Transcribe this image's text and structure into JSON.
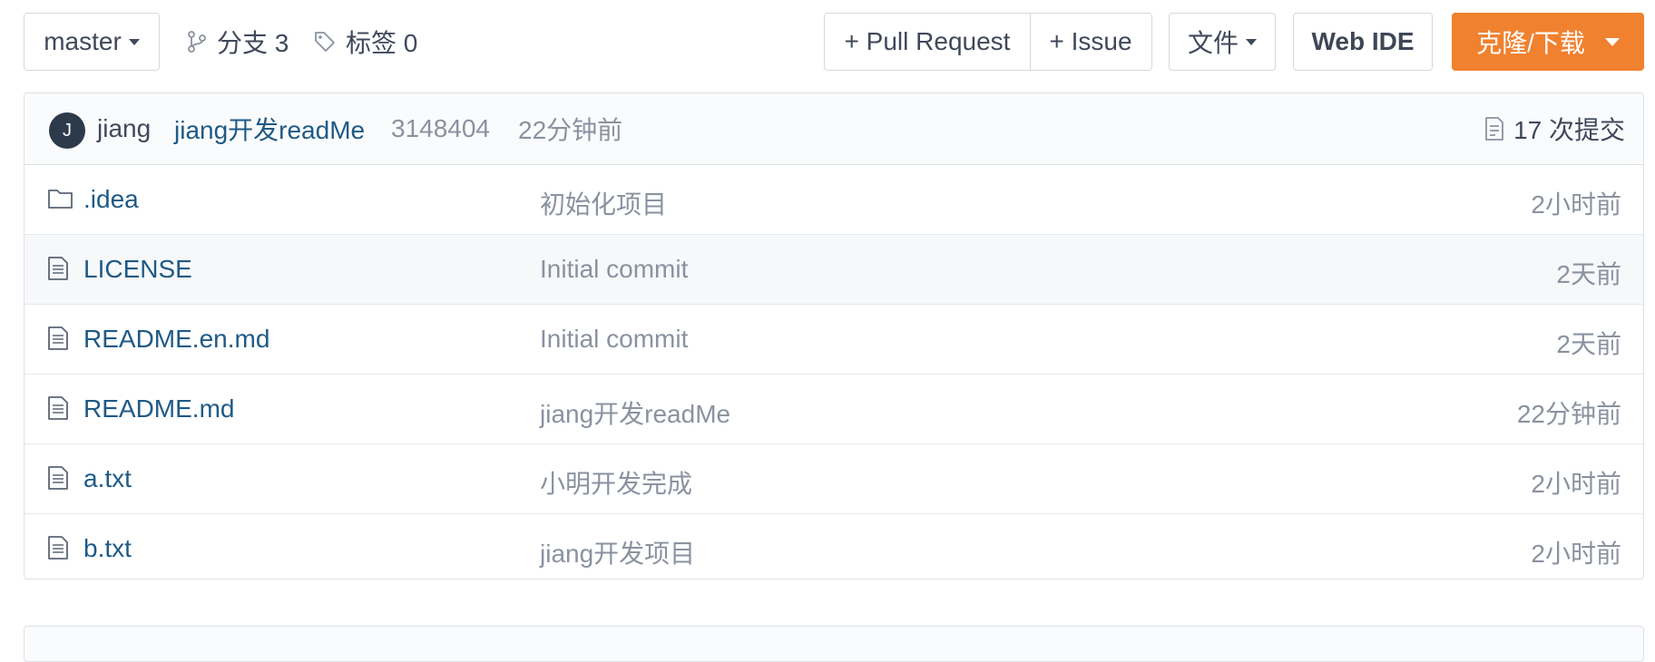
{
  "toolbar": {
    "branch_select": "master",
    "branches_label": "分支 3",
    "tags_label": "标签 0",
    "pull_request_label": "+ Pull Request",
    "issue_label": "+ Issue",
    "file_label": "文件",
    "web_ide_label": "Web IDE",
    "clone_label": "克隆/下载"
  },
  "commit": {
    "avatar_initial": "J",
    "author": "jiang",
    "message": "jiang开发readMe",
    "sha": "3148404",
    "time": "22分钟前",
    "count_label": "17 次提交"
  },
  "files": [
    {
      "name": ".idea",
      "type": "folder",
      "message": "初始化项目",
      "time": "2小时前"
    },
    {
      "name": "LICENSE",
      "type": "file",
      "message": "Initial commit",
      "time": "2天前"
    },
    {
      "name": "README.en.md",
      "type": "file",
      "message": "Initial commit",
      "time": "2天前"
    },
    {
      "name": "README.md",
      "type": "file",
      "message": "jiang开发readMe",
      "time": "22分钟前"
    },
    {
      "name": "a.txt",
      "type": "file",
      "message": "小明开发完成",
      "time": "2小时前"
    },
    {
      "name": "b.txt",
      "type": "file",
      "message": "jiang开发项目",
      "time": "2小时前"
    }
  ],
  "colors": {
    "accent": "#f0812f",
    "link": "#1f5a86",
    "muted": "#8a92a0",
    "avatar_bg": "#2c3a4c"
  },
  "icons": {
    "branch": "branch-icon",
    "tag": "tag-icon",
    "folder": "folder-icon",
    "file": "file-icon",
    "commits": "commit-list-icon"
  }
}
